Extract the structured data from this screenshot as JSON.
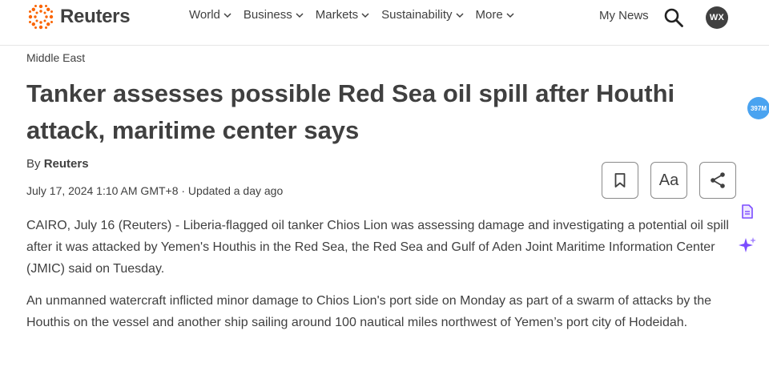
{
  "header": {
    "brand": "Reuters",
    "nav": [
      {
        "label": "World"
      },
      {
        "label": "Business"
      },
      {
        "label": "Markets"
      },
      {
        "label": "Sustainability"
      },
      {
        "label": "More"
      }
    ],
    "my_news": "My News",
    "avatar_initials": "WX"
  },
  "article": {
    "section": "Middle East",
    "headline": "Tanker assesses possible Red Sea oil spill after Houthi attack, maritime center says",
    "byline_prefix": "By",
    "author": "Reuters",
    "dateline": "July 17, 2024 1:10 AM GMT+8 · Updated a day ago",
    "paragraphs": [
      "CAIRO, July 16 (Reuters) - Liberia-flagged oil tanker Chios Lion was assessing damage and investigating a potential oil spill after it was attacked by Yemen's Houthis in the Red Sea, the Red Sea and Gulf of Aden Joint Maritime Information Center (JMIC) said on Tuesday.",
      "An unmanned watercraft inflicted minor damage to Chios Lion's port side on Monday as part of a swarm of attacks by the Houthis on the vessel and another ship sailing around 100 nautical miles northwest of Yemen’s port city of Hodeidah."
    ]
  },
  "tools": {
    "font_size_label": "Aa"
  },
  "side_widget": {
    "badge": "397M"
  },
  "colors": {
    "brand_orange": "#fa6400",
    "text": "#404040",
    "badge_blue": "#4aa3f0",
    "ai_purple": "#7b4dff"
  }
}
